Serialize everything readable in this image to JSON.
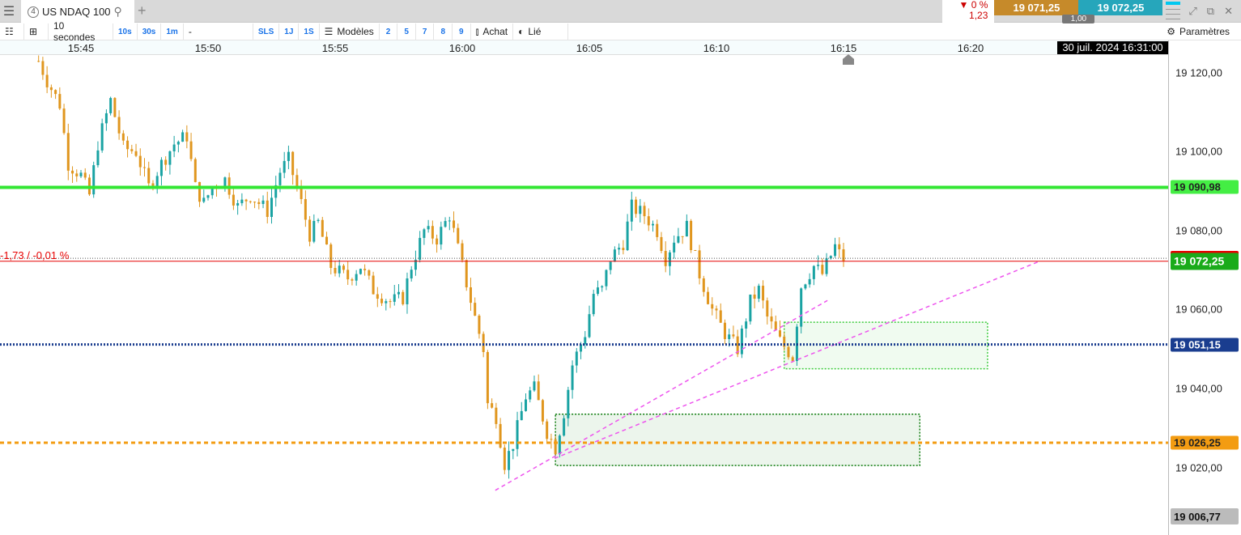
{
  "tabbar": {
    "menu_icon": "hamburger-icon",
    "tab_number": "4",
    "tab_title": "US NDAQ 100",
    "search_icon": "search-icon",
    "add_tab_icon": "plus-icon"
  },
  "quote": {
    "change_pct": "▼ 0 %",
    "change_abs": "1,23",
    "bid": "19 071,25",
    "ask": "19 072,25",
    "spread": "1,00",
    "bid_color": "#c68a2a",
    "ask_color": "#26a6bb"
  },
  "window_icons": [
    "expand-icon",
    "popout-icon",
    "close-icon"
  ],
  "toolbar": {
    "interval": "10 secondes",
    "quick_intervals": [
      "10s",
      "30s",
      "1m"
    ],
    "dash": "-",
    "periods": [
      "SLS",
      "1J",
      "1S"
    ],
    "models": "Modèles",
    "presets": [
      "2",
      "5",
      "7",
      "8",
      "9"
    ],
    "buy": "Achat",
    "linked": "Lié",
    "settings": "Paramètres"
  },
  "time_axis": {
    "labels": [
      "15:45",
      "15:50",
      "15:55",
      "16:00",
      "16:05",
      "16:10",
      "16:15",
      "16:20"
    ],
    "cursor_time": "30 juil. 2024 16:31:00"
  },
  "price_axis": {
    "labels": [
      "19 120,00",
      "19 100,00",
      "19 080,00",
      "19 060,00",
      "19 040,00",
      "19 020,00"
    ],
    "bottom_label": "19 006,77"
  },
  "chart_data": {
    "type": "candlestick",
    "timeframe": "10s",
    "ylim": [
      19003.7,
      19124.5
    ],
    "price_path": [
      [
        "15:43:20",
        19123
      ],
      [
        "15:43:40",
        19118
      ],
      [
        "15:44:10",
        19112
      ],
      [
        "15:44:30",
        19097
      ],
      [
        "15:45:00",
        19094
      ],
      [
        "15:45:20",
        19089
      ],
      [
        "15:45:40",
        19102
      ],
      [
        "15:46:10",
        19113
      ],
      [
        "15:46:40",
        19101
      ],
      [
        "15:47:10",
        19100
      ],
      [
        "15:47:40",
        19091
      ],
      [
        "15:48:10",
        19097
      ],
      [
        "15:48:40",
        19102
      ],
      [
        "15:49:10",
        19104
      ],
      [
        "15:49:30",
        19091
      ],
      [
        "15:49:50",
        19087
      ],
      [
        "15:50:10",
        19091
      ],
      [
        "15:50:40",
        19093
      ],
      [
        "15:51:10",
        19086
      ],
      [
        "15:51:40",
        19089
      ],
      [
        "15:52:20",
        19085
      ],
      [
        "15:52:50",
        19095
      ],
      [
        "15:53:10",
        19098
      ],
      [
        "15:53:40",
        19087
      ],
      [
        "15:54:00",
        19079
      ],
      [
        "15:54:20",
        19082
      ],
      [
        "15:54:50",
        19071
      ],
      [
        "15:55:30",
        19068
      ],
      [
        "15:56:00",
        19071
      ],
      [
        "15:56:30",
        19065
      ],
      [
        "15:57:10",
        19062
      ],
      [
        "15:57:40",
        19063
      ],
      [
        "15:58:00",
        19071
      ],
      [
        "15:58:30",
        19080
      ],
      [
        "15:59:00",
        19078
      ],
      [
        "15:59:30",
        19084
      ],
      [
        "16:00:00",
        19071
      ],
      [
        "16:00:30",
        19058
      ],
      [
        "16:00:50",
        19050
      ],
      [
        "16:01:00",
        19036
      ],
      [
        "16:01:20",
        19033
      ],
      [
        "16:01:40",
        19021
      ],
      [
        "16:02:00",
        19026
      ],
      [
        "16:02:30",
        19038
      ],
      [
        "16:02:50",
        19040
      ],
      [
        "16:03:20",
        19029
      ],
      [
        "16:03:40",
        19025
      ],
      [
        "16:04:00",
        19034
      ],
      [
        "16:04:20",
        19046
      ],
      [
        "16:04:50",
        19054
      ],
      [
        "16:05:10",
        19064
      ],
      [
        "16:05:30",
        19065
      ],
      [
        "16:05:50",
        19073
      ],
      [
        "16:06:20",
        19077
      ],
      [
        "16:06:40",
        19086
      ],
      [
        "16:07:10",
        19084
      ],
      [
        "16:07:40",
        19080
      ],
      [
        "16:08:00",
        19073
      ],
      [
        "16:08:20",
        19078
      ],
      [
        "16:08:50",
        19081
      ],
      [
        "16:09:20",
        19069
      ],
      [
        "16:09:50",
        19060
      ],
      [
        "16:10:20",
        19054
      ],
      [
        "16:10:50",
        19050
      ],
      [
        "16:11:20",
        19062
      ],
      [
        "16:11:40",
        19065
      ],
      [
        "16:12:00",
        19058
      ],
      [
        "16:12:30",
        19052
      ],
      [
        "16:13:00",
        19048
      ],
      [
        "16:13:20",
        19066
      ],
      [
        "16:13:50",
        19071
      ],
      [
        "16:14:10",
        19069
      ],
      [
        "16:14:40",
        19076
      ],
      [
        "16:15:00",
        19072.25
      ]
    ],
    "up_color": "#1aa3a3",
    "down_color": "#e0961e",
    "hlines": [
      {
        "price": 19090.98,
        "label": "19 090,98",
        "color": "#33e633",
        "style": "solid"
      },
      {
        "price": 19051.15,
        "label": "19 051,15",
        "color": "#1a3d8f",
        "style": "dotted"
      },
      {
        "price": 19026.25,
        "label": "19 026,25",
        "color": "#f39c12",
        "style": "dashed"
      }
    ],
    "last_price": {
      "price": 19072.25,
      "label": "19 072,25",
      "color": "#1aab1a",
      "line_color": "#e60000"
    },
    "ref_line": {
      "price": 19073.0,
      "label": "-1,73 / -0,01 %",
      "color": "#e60000"
    },
    "zones": [
      {
        "from": "16:03:40",
        "to": "16:18:00",
        "low": 19020.5,
        "high": 19033.5,
        "color": "#0b7a0b"
      },
      {
        "from": "16:12:40",
        "to": "16:20:40",
        "low": 19045,
        "high": 19056.8,
        "color": "#3ccc3c"
      }
    ],
    "trendlines": [
      {
        "t1": "16:01:18",
        "p1": 19014.2,
        "t2": "16:14:22",
        "p2": 19062.3,
        "color": "#ee55ee"
      },
      {
        "t1": "16:03:38",
        "p1": 19022.3,
        "t2": "16:22:44",
        "p2": 19072.3,
        "color": "#ee55ee"
      }
    ]
  }
}
